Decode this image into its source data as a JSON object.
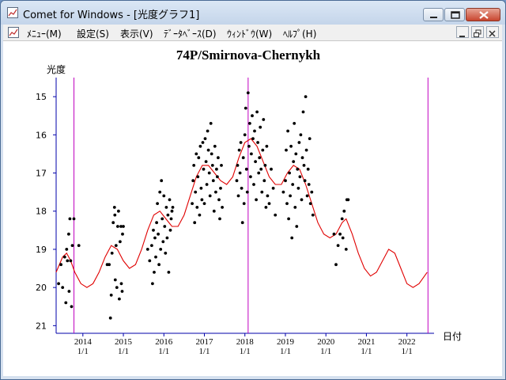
{
  "window": {
    "title": "Comet for Windows - [光度グラフ1]"
  },
  "menubar": {
    "items": [
      {
        "label": "ﾒﾆｭｰ(M)",
        "name": "menu-item-menu"
      },
      {
        "label": "設定(S)",
        "name": "menu-item-settings"
      },
      {
        "label": "表示(V)",
        "name": "menu-item-view"
      },
      {
        "label": "ﾃﾞｰﾀﾍﾞｰｽ(D)",
        "name": "menu-item-database"
      },
      {
        "label": "ｳｨﾝﾄﾞｳ(W)",
        "name": "menu-item-window"
      },
      {
        "label": "ﾍﾙﾌﾟ(H)",
        "name": "menu-item-help"
      }
    ]
  },
  "icons": [
    "app-icon",
    "minimize-icon",
    "maximize-icon",
    "close-icon",
    "document-icon",
    "restore-icon"
  ],
  "chart_data": {
    "type": "scatter",
    "title": "74P/Smirnova-Chernykh",
    "ylabel": "光度",
    "xlabel": "日付",
    "ylim": [
      21.2,
      14.5
    ],
    "xlim": [
      2013.34,
      2022.67
    ],
    "y_ticks": [
      15,
      16,
      17,
      18,
      19,
      20,
      21
    ],
    "x_ticks": [
      {
        "year": 2014,
        "label_top": "2014",
        "label_bottom": "1/1"
      },
      {
        "year": 2015,
        "label_top": "2015",
        "label_bottom": "1/1"
      },
      {
        "year": 2016,
        "label_top": "2016",
        "label_bottom": "1/1"
      },
      {
        "year": 2017,
        "label_top": "2017",
        "label_bottom": "1/1"
      },
      {
        "year": 2018,
        "label_top": "2018",
        "label_bottom": "1/1"
      },
      {
        "year": 2019,
        "label_top": "2019",
        "label_bottom": "1/1"
      },
      {
        "year": 2020,
        "label_top": "2020",
        "label_bottom": "1/1"
      },
      {
        "year": 2021,
        "label_top": "2021",
        "label_bottom": "1/1"
      },
      {
        "year": 2022,
        "label_top": "2022",
        "label_bottom": "1/1"
      }
    ],
    "perihelion_lines": [
      2013.78,
      2018.08,
      2022.52
    ],
    "colors": {
      "points": "#000000",
      "curve": "#e00000",
      "perihelion": "#c000c0",
      "axis": "#0000aa",
      "text": "#000000"
    },
    "curve": [
      [
        2013.34,
        19.6
      ],
      [
        2013.5,
        19.2
      ],
      [
        2013.6,
        19.1
      ],
      [
        2013.7,
        19.3
      ],
      [
        2013.8,
        19.6
      ],
      [
        2013.95,
        19.9
      ],
      [
        2014.1,
        20.0
      ],
      [
        2014.25,
        19.9
      ],
      [
        2014.4,
        19.6
      ],
      [
        2014.55,
        19.2
      ],
      [
        2014.7,
        18.9
      ],
      [
        2014.85,
        19.0
      ],
      [
        2015.0,
        19.3
      ],
      [
        2015.15,
        19.5
      ],
      [
        2015.3,
        19.4
      ],
      [
        2015.45,
        19.0
      ],
      [
        2015.6,
        18.5
      ],
      [
        2015.75,
        18.1
      ],
      [
        2015.9,
        18.0
      ],
      [
        2016.05,
        18.2
      ],
      [
        2016.2,
        18.4
      ],
      [
        2016.35,
        18.4
      ],
      [
        2016.5,
        18.1
      ],
      [
        2016.65,
        17.6
      ],
      [
        2016.8,
        17.1
      ],
      [
        2016.95,
        16.8
      ],
      [
        2017.1,
        16.8
      ],
      [
        2017.25,
        17.0
      ],
      [
        2017.4,
        17.2
      ],
      [
        2017.55,
        17.3
      ],
      [
        2017.7,
        17.1
      ],
      [
        2017.85,
        16.6
      ],
      [
        2018.0,
        16.2
      ],
      [
        2018.15,
        16.1
      ],
      [
        2018.3,
        16.3
      ],
      [
        2018.45,
        16.7
      ],
      [
        2018.6,
        17.1
      ],
      [
        2018.75,
        17.3
      ],
      [
        2018.9,
        17.3
      ],
      [
        2019.05,
        17.0
      ],
      [
        2019.2,
        16.8
      ],
      [
        2019.35,
        16.9
      ],
      [
        2019.5,
        17.3
      ],
      [
        2019.65,
        17.8
      ],
      [
        2019.8,
        18.3
      ],
      [
        2019.95,
        18.6
      ],
      [
        2020.1,
        18.7
      ],
      [
        2020.25,
        18.6
      ],
      [
        2020.4,
        18.3
      ],
      [
        2020.5,
        18.2
      ],
      [
        2020.65,
        18.6
      ],
      [
        2020.8,
        19.1
      ],
      [
        2020.95,
        19.5
      ],
      [
        2021.1,
        19.7
      ],
      [
        2021.25,
        19.6
      ],
      [
        2021.4,
        19.3
      ],
      [
        2021.55,
        19.0
      ],
      [
        2021.7,
        19.1
      ],
      [
        2021.85,
        19.5
      ],
      [
        2022.0,
        19.9
      ],
      [
        2022.15,
        20.0
      ],
      [
        2022.3,
        19.9
      ],
      [
        2022.5,
        19.6
      ]
    ],
    "points": [
      [
        2013.4,
        19.9
      ],
      [
        2013.46,
        19.4
      ],
      [
        2013.5,
        20.0
      ],
      [
        2013.55,
        19.2
      ],
      [
        2013.58,
        20.4
      ],
      [
        2013.6,
        19.0
      ],
      [
        2013.62,
        19.3
      ],
      [
        2013.65,
        18.6
      ],
      [
        2013.66,
        20.1
      ],
      [
        2013.68,
        18.2
      ],
      [
        2013.7,
        19.3
      ],
      [
        2013.72,
        20.5
      ],
      [
        2013.74,
        18.9
      ],
      [
        2013.78,
        18.2
      ],
      [
        2013.9,
        18.9
      ],
      [
        2014.6,
        19.4
      ],
      [
        2014.65,
        19.4
      ],
      [
        2014.68,
        20.8
      ],
      [
        2014.7,
        20.2
      ],
      [
        2014.72,
        19.1
      ],
      [
        2014.75,
        18.3
      ],
      [
        2014.78,
        17.9
      ],
      [
        2014.79,
        18.1
      ],
      [
        2014.8,
        19.8
      ],
      [
        2014.82,
        18.9
      ],
      [
        2014.84,
        20.0
      ],
      [
        2014.86,
        18.4
      ],
      [
        2014.88,
        18.0
      ],
      [
        2014.9,
        20.3
      ],
      [
        2014.92,
        18.8
      ],
      [
        2014.94,
        18.4
      ],
      [
        2014.95,
        19.9
      ],
      [
        2014.97,
        20.1
      ],
      [
        2014.98,
        18.6
      ],
      [
        2015.0,
        18.4
      ],
      [
        2015.6,
        19.0
      ],
      [
        2015.65,
        19.3
      ],
      [
        2015.7,
        18.9
      ],
      [
        2015.72,
        19.9
      ],
      [
        2015.74,
        18.5
      ],
      [
        2015.76,
        19.6
      ],
      [
        2015.78,
        18.7
      ],
      [
        2015.8,
        19.2
      ],
      [
        2015.82,
        18.3
      ],
      [
        2015.84,
        17.8
      ],
      [
        2015.86,
        18.6
      ],
      [
        2015.88,
        19.4
      ],
      [
        2015.9,
        17.5
      ],
      [
        2015.92,
        19.0
      ],
      [
        2015.94,
        17.2
      ],
      [
        2015.96,
        18.2
      ],
      [
        2015.98,
        18.8
      ],
      [
        2016.0,
        17.6
      ],
      [
        2016.02,
        18.4
      ],
      [
        2016.04,
        19.1
      ],
      [
        2016.06,
        17.9
      ],
      [
        2016.08,
        18.7
      ],
      [
        2016.1,
        18.1
      ],
      [
        2016.12,
        19.6
      ],
      [
        2016.14,
        17.7
      ],
      [
        2016.16,
        18.5
      ],
      [
        2016.18,
        18.2
      ],
      [
        2016.2,
        18.0
      ],
      [
        2016.22,
        17.9
      ],
      [
        2016.7,
        17.8
      ],
      [
        2016.72,
        17.2
      ],
      [
        2016.74,
        16.8
      ],
      [
        2016.76,
        18.3
      ],
      [
        2016.78,
        17.5
      ],
      [
        2016.8,
        16.5
      ],
      [
        2016.82,
        17.9
      ],
      [
        2016.84,
        17.1
      ],
      [
        2016.86,
        16.6
      ],
      [
        2016.88,
        18.1
      ],
      [
        2016.9,
        16.3
      ],
      [
        2016.92,
        17.4
      ],
      [
        2016.94,
        17.7
      ],
      [
        2016.96,
        16.2
      ],
      [
        2016.98,
        16.9
      ],
      [
        2017.0,
        17.8
      ],
      [
        2017.02,
        16.1
      ],
      [
        2017.04,
        16.7
      ],
      [
        2017.06,
        17.3
      ],
      [
        2017.08,
        15.9
      ],
      [
        2017.1,
        16.4
      ],
      [
        2017.12,
        17.0
      ],
      [
        2017.14,
        17.6
      ],
      [
        2017.16,
        15.7
      ],
      [
        2017.18,
        16.5
      ],
      [
        2017.2,
        16.8
      ],
      [
        2017.22,
        17.2
      ],
      [
        2017.24,
        18.0
      ],
      [
        2017.26,
        16.3
      ],
      [
        2017.28,
        17.5
      ],
      [
        2017.3,
        16.9
      ],
      [
        2017.32,
        17.1
      ],
      [
        2017.34,
        16.6
      ],
      [
        2017.36,
        17.7
      ],
      [
        2017.38,
        18.2
      ],
      [
        2017.4,
        17.4
      ],
      [
        2017.42,
        16.8
      ],
      [
        2017.44,
        17.9
      ],
      [
        2017.8,
        17.2
      ],
      [
        2017.82,
        16.8
      ],
      [
        2017.84,
        17.6
      ],
      [
        2017.86,
        16.4
      ],
      [
        2017.88,
        17.0
      ],
      [
        2017.9,
        16.2
      ],
      [
        2017.92,
        17.4
      ],
      [
        2017.94,
        18.3
      ],
      [
        2017.96,
        16.6
      ],
      [
        2017.98,
        17.8
      ],
      [
        2018.0,
        16.0
      ],
      [
        2018.02,
        15.3
      ],
      [
        2018.04,
        16.9
      ],
      [
        2018.06,
        17.5
      ],
      [
        2018.08,
        14.9
      ],
      [
        2018.1,
        16.3
      ],
      [
        2018.12,
        15.7
      ],
      [
        2018.14,
        17.1
      ],
      [
        2018.16,
        16.5
      ],
      [
        2018.18,
        15.5
      ],
      [
        2018.2,
        16.1
      ],
      [
        2018.22,
        17.3
      ],
      [
        2018.24,
        15.9
      ],
      [
        2018.26,
        16.7
      ],
      [
        2018.28,
        17.7
      ],
      [
        2018.3,
        15.4
      ],
      [
        2018.32,
        16.2
      ],
      [
        2018.34,
        17.0
      ],
      [
        2018.36,
        16.6
      ],
      [
        2018.38,
        15.8
      ],
      [
        2018.4,
        16.9
      ],
      [
        2018.42,
        17.5
      ],
      [
        2018.44,
        16.4
      ],
      [
        2018.46,
        15.6
      ],
      [
        2018.48,
        17.2
      ],
      [
        2018.5,
        16.8
      ],
      [
        2018.52,
        17.9
      ],
      [
        2018.54,
        16.3
      ],
      [
        2018.56,
        17.6
      ],
      [
        2018.6,
        17.8
      ],
      [
        2018.65,
        16.9
      ],
      [
        2018.7,
        17.4
      ],
      [
        2018.75,
        18.1
      ],
      [
        2018.95,
        17.5
      ],
      [
        2019.0,
        17.2
      ],
      [
        2019.02,
        16.4
      ],
      [
        2019.04,
        17.8
      ],
      [
        2019.06,
        15.9
      ],
      [
        2019.08,
        18.2
      ],
      [
        2019.1,
        17.0
      ],
      [
        2019.12,
        17.6
      ],
      [
        2019.14,
        16.3
      ],
      [
        2019.16,
        18.7
      ],
      [
        2019.18,
        17.3
      ],
      [
        2019.2,
        16.7
      ],
      [
        2019.22,
        15.7
      ],
      [
        2019.24,
        17.9
      ],
      [
        2019.26,
        16.5
      ],
      [
        2019.28,
        18.4
      ],
      [
        2019.3,
        16.9
      ],
      [
        2019.32,
        17.4
      ],
      [
        2019.34,
        16.2
      ],
      [
        2019.36,
        17.1
      ],
      [
        2019.38,
        16.0
      ],
      [
        2019.4,
        17.7
      ],
      [
        2019.42,
        16.6
      ],
      [
        2019.44,
        15.4
      ],
      [
        2019.46,
        16.8
      ],
      [
        2019.48,
        17.2
      ],
      [
        2019.5,
        15.0
      ],
      [
        2019.52,
        16.4
      ],
      [
        2019.54,
        17.6
      ],
      [
        2019.56,
        16.9
      ],
      [
        2019.58,
        17.3
      ],
      [
        2019.6,
        16.1
      ],
      [
        2019.62,
        17.8
      ],
      [
        2019.65,
        17.5
      ],
      [
        2019.68,
        18.1
      ],
      [
        2020.2,
        18.6
      ],
      [
        2020.25,
        19.4
      ],
      [
        2020.3,
        18.9
      ],
      [
        2020.35,
        18.6
      ],
      [
        2020.4,
        18.2
      ],
      [
        2020.42,
        18.7
      ],
      [
        2020.45,
        18.0
      ],
      [
        2020.5,
        19.0
      ],
      [
        2020.52,
        17.7
      ],
      [
        2020.55,
        17.7
      ]
    ]
  }
}
